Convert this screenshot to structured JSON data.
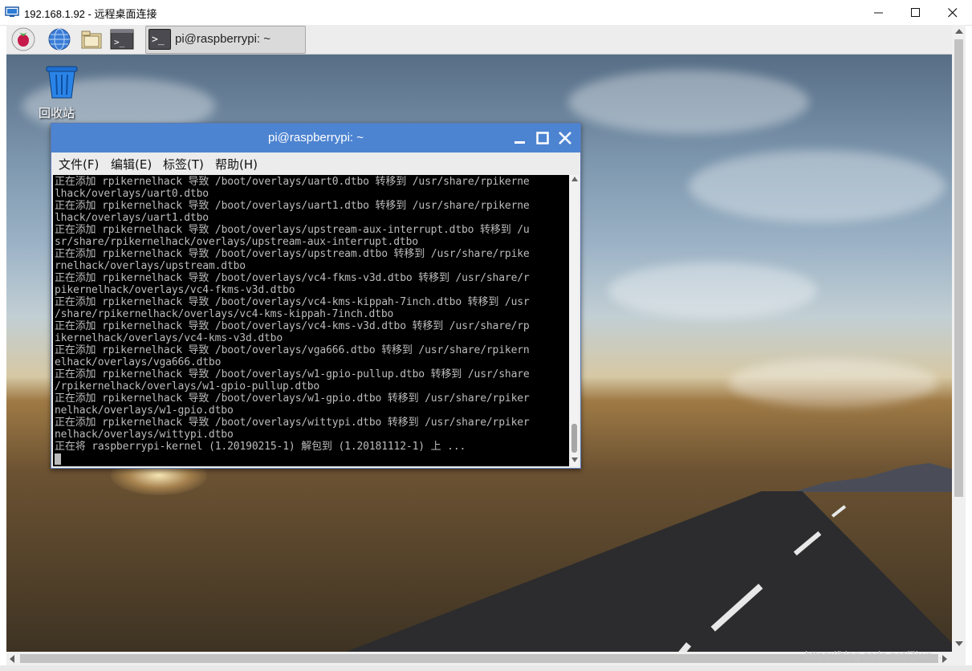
{
  "rdp_window": {
    "title": "192.168.1.92 - 远程桌面连接",
    "minimize": "—",
    "maximize": "☐",
    "close": "✕"
  },
  "taskbar": {
    "task_label": "pi@raspberrypi: ~",
    "task_icon": ">_"
  },
  "desktop": {
    "trash_label": "回收站"
  },
  "terminal": {
    "title": "pi@raspberrypi: ~",
    "menu": [
      "文件(F)",
      "编辑(E)",
      "标签(T)",
      "帮助(H)"
    ],
    "lines": [
      "正在添加 rpikernelhack 导致 /boot/overlays/uart0.dtbo 转移到 /usr/share/rpikerne",
      "lhack/overlays/uart0.dtbo",
      "正在添加 rpikernelhack 导致 /boot/overlays/uart1.dtbo 转移到 /usr/share/rpikerne",
      "lhack/overlays/uart1.dtbo",
      "正在添加 rpikernelhack 导致 /boot/overlays/upstream-aux-interrupt.dtbo 转移到 /u",
      "sr/share/rpikernelhack/overlays/upstream-aux-interrupt.dtbo",
      "正在添加 rpikernelhack 导致 /boot/overlays/upstream.dtbo 转移到 /usr/share/rpike",
      "rnelhack/overlays/upstream.dtbo",
      "正在添加 rpikernelhack 导致 /boot/overlays/vc4-fkms-v3d.dtbo 转移到 /usr/share/r",
      "pikernelhack/overlays/vc4-fkms-v3d.dtbo",
      "正在添加 rpikernelhack 导致 /boot/overlays/vc4-kms-kippah-7inch.dtbo 转移到 /usr",
      "/share/rpikernelhack/overlays/vc4-kms-kippah-7inch.dtbo",
      "正在添加 rpikernelhack 导致 /boot/overlays/vc4-kms-v3d.dtbo 转移到 /usr/share/rp",
      "ikernelhack/overlays/vc4-kms-v3d.dtbo",
      "正在添加 rpikernelhack 导致 /boot/overlays/vga666.dtbo 转移到 /usr/share/rpikern",
      "elhack/overlays/vga666.dtbo",
      "正在添加 rpikernelhack 导致 /boot/overlays/w1-gpio-pullup.dtbo 转移到 /usr/share",
      "/rpikernelhack/overlays/w1-gpio-pullup.dtbo",
      "正在添加 rpikernelhack 导致 /boot/overlays/w1-gpio.dtbo 转移到 /usr/share/rpiker",
      "nelhack/overlays/w1-gpio.dtbo",
      "正在添加 rpikernelhack 导致 /boot/overlays/wittypi.dtbo 转移到 /usr/share/rpiker",
      "nelhack/overlays/wittypi.dtbo",
      "正在将 raspberrypi-kernel (1.20190215-1) 解包到 (1.20181112-1) 上 ..."
    ]
  },
  "watermark": "https://blog.csdn.net/Ziwe...",
  "colors": {
    "terminal_titlebar": "#4d84d1",
    "terminal_text": "#bcbcbc",
    "terminal_bg": "#000000"
  }
}
